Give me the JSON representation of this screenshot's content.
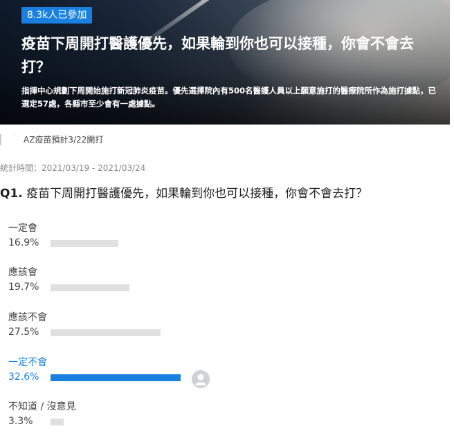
{
  "banner": {
    "badge": "8.3k人已參加",
    "title": "疫苗下周開打醫護優先，如果輪到你也可以接種，你會不會去打？",
    "description": "指揮中心規劃下周開始施打新冠肺炎疫苗。優先選擇院內有500名醫護人員以上願意施打的醫療院所作為施打據點，已選定57處，各縣市至少會有一處據點。"
  },
  "tag": {
    "label": "AZ疫苗預計3/22開打"
  },
  "survey": {
    "period": "統計時間：2021/03/19 - 2021/03/24",
    "question_no": "Q1.",
    "question_text": "疫苗下周開打醫護優先，如果輪到你也可以接種，你會不會去打？",
    "options": [
      {
        "label": "一定會",
        "percent_text": "16.9%",
        "percent": 16.9,
        "selected": false
      },
      {
        "label": "應該會",
        "percent_text": "19.7%",
        "percent": 19.7,
        "selected": false
      },
      {
        "label": "應該不會",
        "percent_text": "27.5%",
        "percent": 27.5,
        "selected": false
      },
      {
        "label": "一定不會",
        "percent_text": "32.6%",
        "percent": 32.6,
        "selected": true
      },
      {
        "label": "不知道 / 沒意見",
        "percent_text": "3.3%",
        "percent": 3.3,
        "selected": false
      }
    ]
  },
  "colors": {
    "accent": "#1a80e0",
    "bar": "#e0e0e0"
  },
  "icons": {
    "avatar": "user-avatar-icon"
  }
}
